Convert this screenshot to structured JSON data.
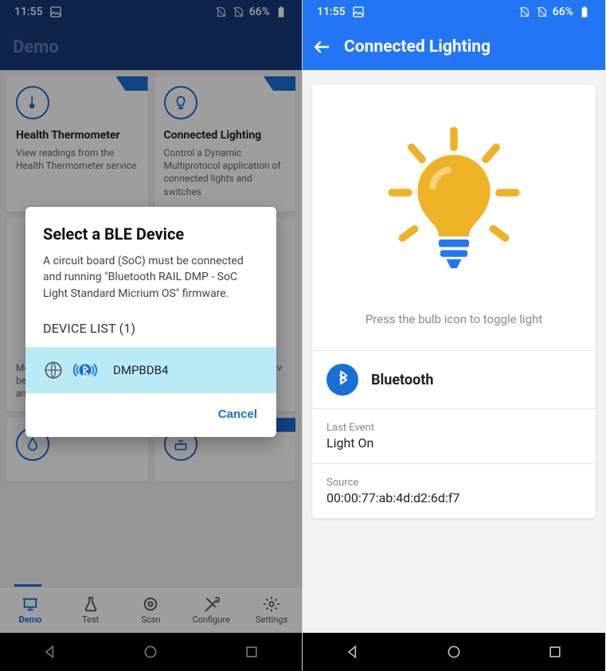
{
  "status": {
    "time": "11:55",
    "battery": "66%"
  },
  "left": {
    "title": "Demo",
    "cards": [
      {
        "title": "Health Thermometer",
        "desc": "View readings from the Health Thermometer service"
      },
      {
        "title": "Connected Lighting",
        "desc": "Control a Dynamic Multiprotocol application of connected lights and switches"
      },
      {
        "title": "",
        "desc": "Measure throughput between the mobile device and EFR32"
      },
      {
        "title": "",
        "desc": "Control a 3D render of a dev kit"
      }
    ],
    "dialog": {
      "title": "Select a BLE Device",
      "desc": "A circuit board (SoC) must be connected and running \"Bluetooth RAIL DMP - SoC Light Standard Micrium OS\" firmware.",
      "device_list_label": "DEVICE LIST (1)",
      "device_name": "DMPBDB4",
      "cancel": "Cancel"
    },
    "tabs": [
      "Demo",
      "Test",
      "Scan",
      "Configure",
      "Settings"
    ]
  },
  "right": {
    "title": "Connected Lighting",
    "instruction": "Press the bulb icon to toggle light",
    "bluetooth_label": "Bluetooth",
    "last_event_label": "Last Event",
    "last_event_value": "Light On",
    "source_label": "Source",
    "source_value": "00:00:77:ab:4d:d2:6d:f7"
  }
}
